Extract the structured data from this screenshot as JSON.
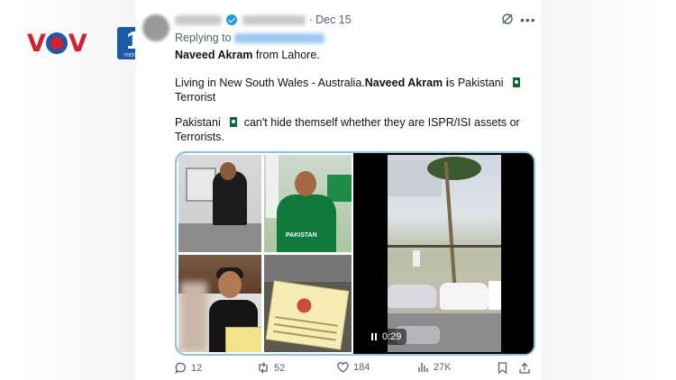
{
  "logo": {
    "brand": "VOV",
    "badge_number": "1",
    "badge_caption": "THỜI SỰ"
  },
  "tweet": {
    "display_name": "TIMOMNY",
    "handle": "@TimmyX",
    "date": "Dec 15",
    "replying_label": "Replying to",
    "replying_handle": "@RealNeilAnderson",
    "line1_bold": "Naveed Akram",
    "line1_rest": "from Lahore.",
    "line2_pre": "Living in New South Wales - Australia.",
    "line2_bold": "Naveed Akram i",
    "line2_post": "s Pakistani",
    "line2_end": "Terrorist",
    "line3_pre": "Pakistani",
    "line3_post": "can't hide themself whether they are ISPR/ISI assets or",
    "line3_end": "Terrorists.",
    "shirt_text": "PAKISTAN",
    "video_time": "0:29"
  },
  "actions": {
    "replies": "12",
    "reposts": "52",
    "likes": "184",
    "views": "27K"
  },
  "colors": {
    "verified": "#1d9bf0",
    "secondary_text": "#536471",
    "media_border": "#8ec3e8",
    "vov_red": "#d6202b",
    "vov_blue": "#1a5aa8"
  }
}
